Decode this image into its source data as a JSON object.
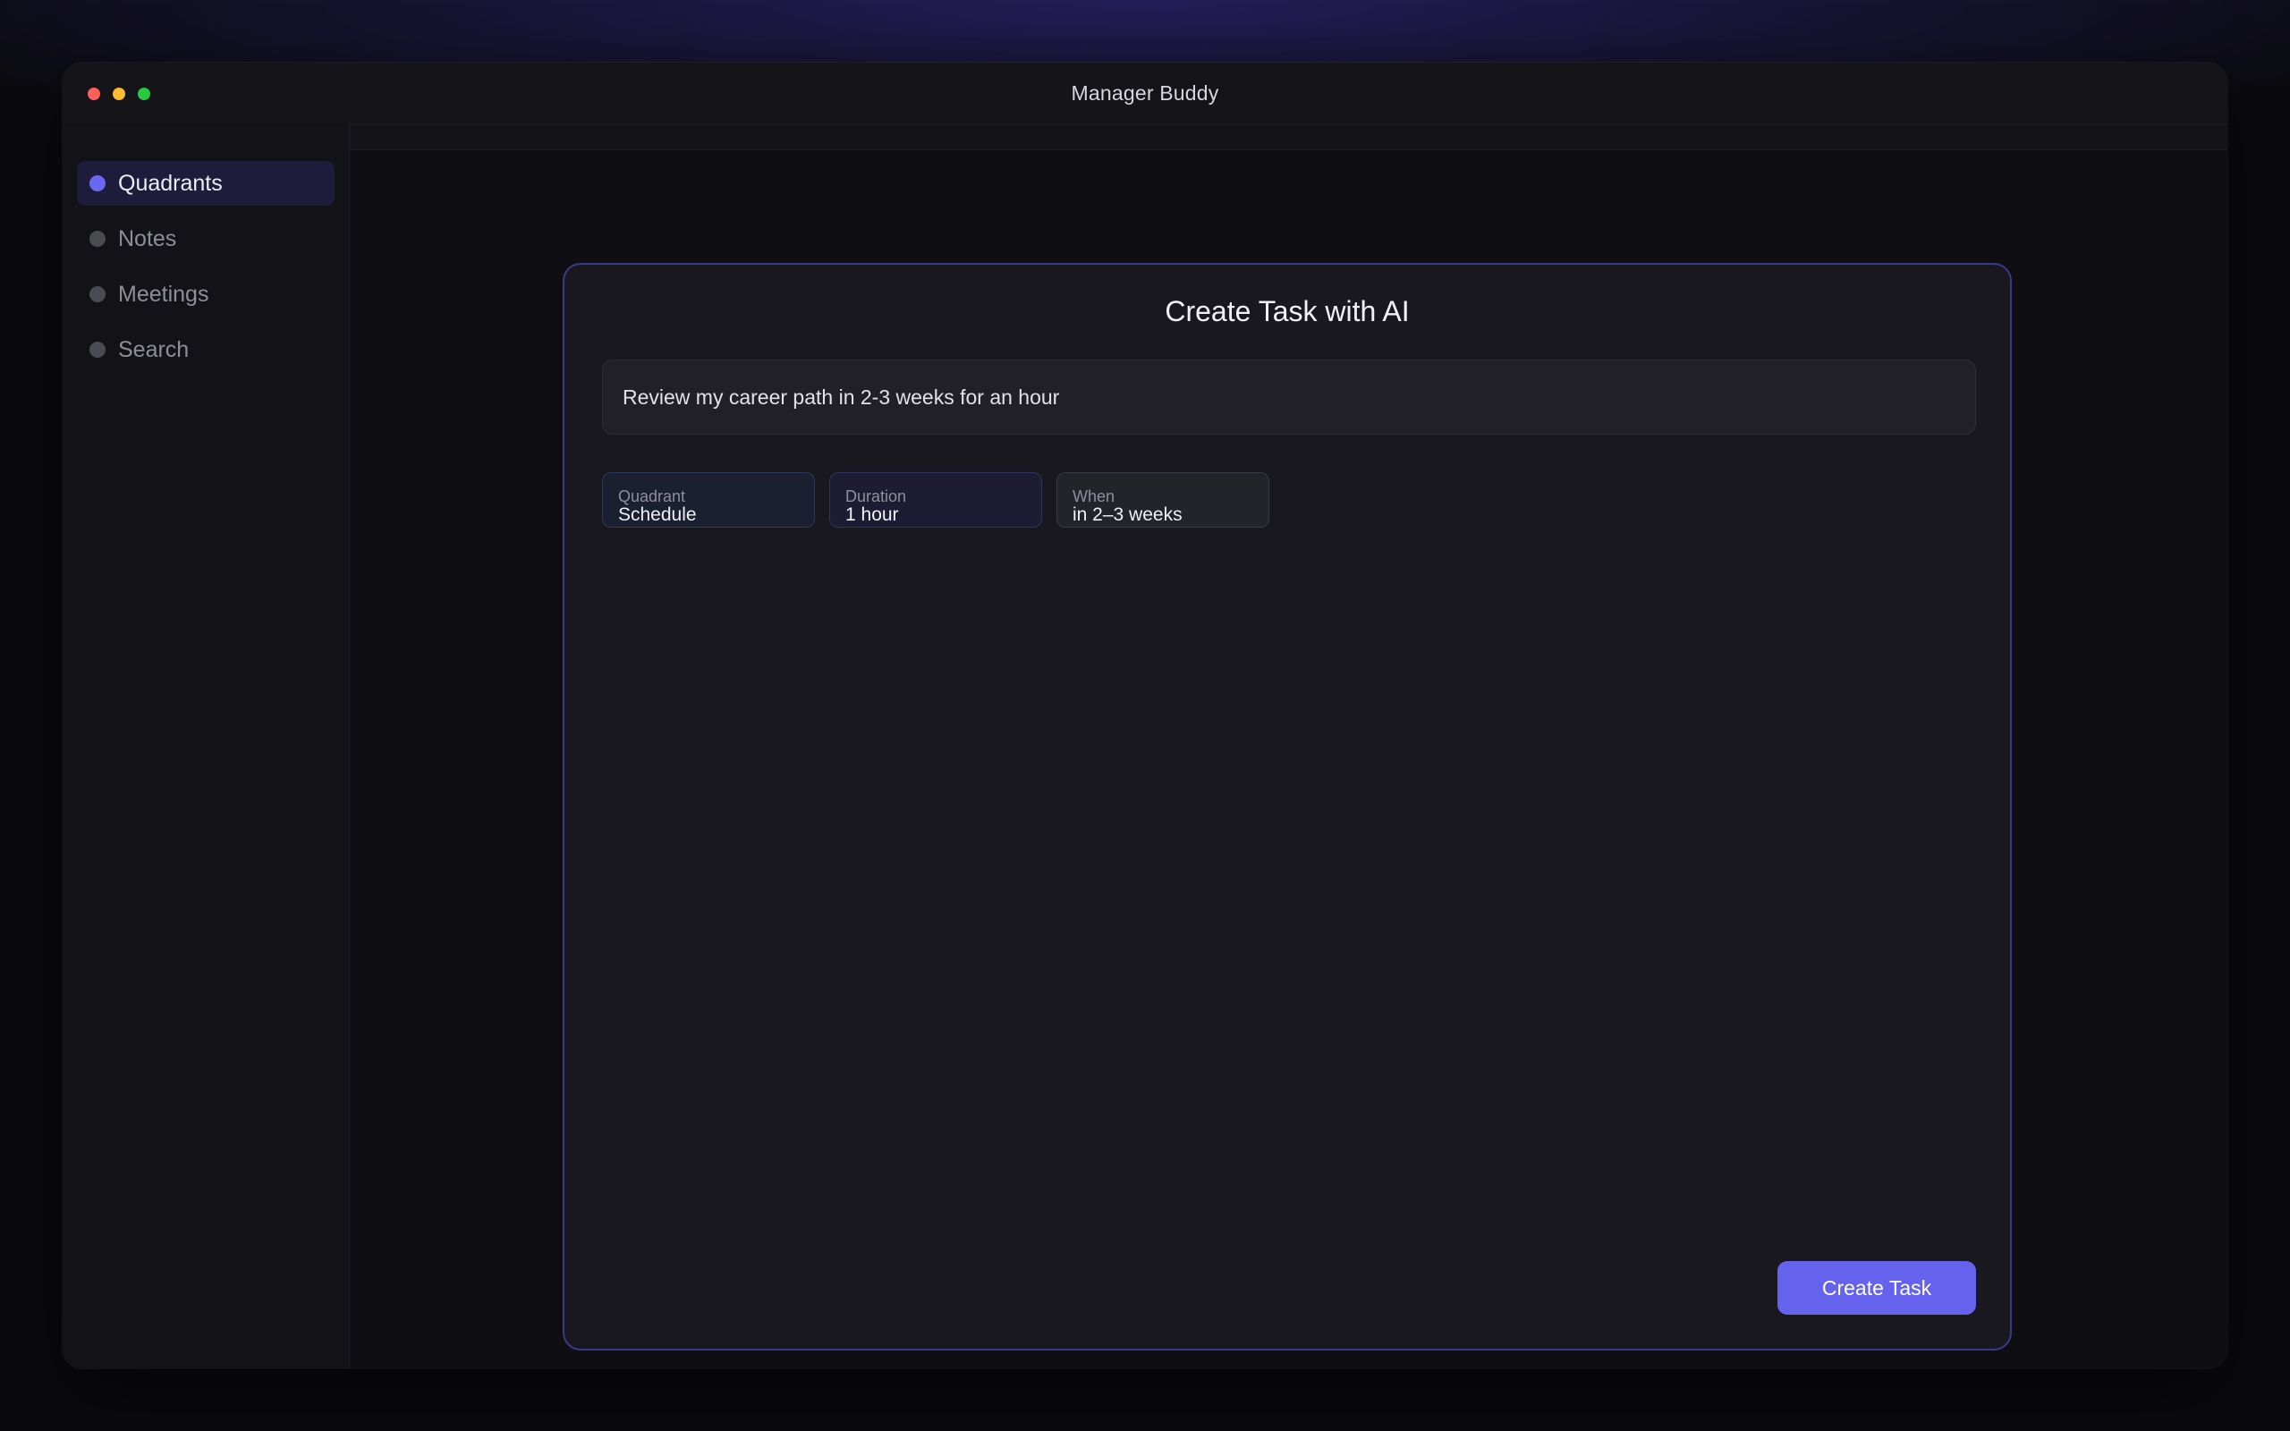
{
  "window": {
    "title": "Manager Buddy"
  },
  "sidebar": {
    "items": [
      {
        "label": "Quadrants",
        "active": true
      },
      {
        "label": "Notes",
        "active": false
      },
      {
        "label": "Meetings",
        "active": false
      },
      {
        "label": "Search",
        "active": false
      }
    ]
  },
  "dialog": {
    "title": "Create Task with AI",
    "prompt_value": "Review my career path in 2-3 weeks for an hour",
    "chips": [
      {
        "label": "Quadrant",
        "value": "Schedule"
      },
      {
        "label": "Duration",
        "value": "1 hour"
      },
      {
        "label": "When",
        "value": "in 2–3 weeks"
      }
    ],
    "submit_label": "Create Task"
  },
  "colors": {
    "accent": "#6563ee",
    "active_nav_bg": "#1d1c3a",
    "card_border": "#3b3a8a"
  }
}
